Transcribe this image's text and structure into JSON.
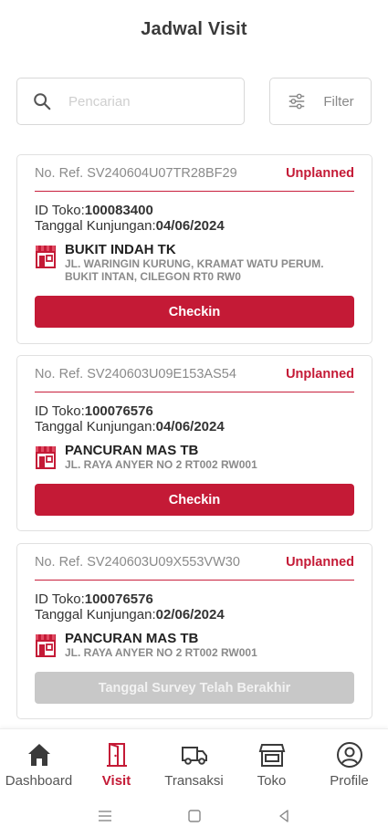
{
  "header": {
    "title": "Jadwal Visit"
  },
  "search": {
    "placeholder": "Pencarian",
    "value": ""
  },
  "filter": {
    "label": "Filter"
  },
  "cards": [
    {
      "ref": "No. Ref. SV240604U07TR28BF29",
      "status": "Unplanned",
      "id_label": "ID Toko:",
      "id_value": "100083400",
      "date_label": "Tanggal Kunjungan:",
      "date_value": "04/06/2024",
      "store_name": "BUKIT INDAH TK",
      "store_address": "JL. WARINGIN KURUNG, KRAMAT WATU PERUM.\nBUKIT INTAN, CILEGON  RT0  RW0",
      "button_label": "Checkin",
      "button_enabled": true
    },
    {
      "ref": "No. Ref. SV240603U09E153AS54",
      "status": "Unplanned",
      "id_label": "ID Toko:",
      "id_value": "100076576",
      "date_label": "Tanggal Kunjungan:",
      "date_value": "04/06/2024",
      "store_name": "PANCURAN MAS TB",
      "store_address": "JL. RAYA ANYER NO 2  RT002  RW001",
      "button_label": "Checkin",
      "button_enabled": true
    },
    {
      "ref": "No. Ref. SV240603U09X553VW30",
      "status": "Unplanned",
      "id_label": "ID Toko:",
      "id_value": "100076576",
      "date_label": "Tanggal Kunjungan:",
      "date_value": "02/06/2024",
      "store_name": "PANCURAN MAS TB",
      "store_address": "JL. RAYA ANYER NO 2  RT002  RW001",
      "button_label": "Tanggal Survey Telah Berakhir",
      "button_enabled": false
    }
  ],
  "nav": {
    "items": [
      {
        "label": "Dashboard",
        "icon": "home-icon",
        "active": false
      },
      {
        "label": "Visit",
        "icon": "door-icon",
        "active": true
      },
      {
        "label": "Transaksi",
        "icon": "truck-icon",
        "active": false
      },
      {
        "label": "Toko",
        "icon": "store-icon",
        "active": false
      },
      {
        "label": "Profile",
        "icon": "user-circle-icon",
        "active": false
      }
    ]
  },
  "colors": {
    "accent": "#c41a36",
    "disabled": "#c8c8c8",
    "muted_text": "#8a8a8a"
  }
}
